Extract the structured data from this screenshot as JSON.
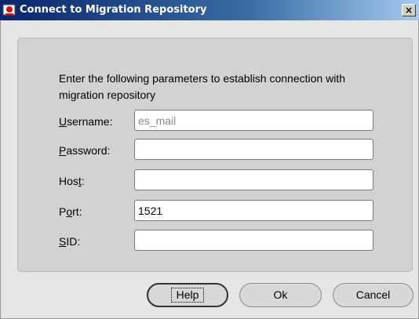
{
  "window": {
    "title": "Connect to Migration Repository",
    "close_glyph": "×",
    "icon": "oracle-app-icon"
  },
  "form": {
    "instructions": "Enter the following parameters to establish connection with migration repository",
    "username": {
      "mnemonic": "U",
      "rest": "sername:",
      "value": "es_mail",
      "enabled": false
    },
    "password": {
      "mnemonic": "P",
      "rest": "assword:",
      "value": ""
    },
    "host": {
      "pre": "Hos",
      "mnemonic": "t",
      "rest": ":",
      "value": ""
    },
    "port": {
      "pre": "P",
      "mnemonic": "o",
      "rest": "rt:",
      "value": "1521"
    },
    "sid": {
      "mnemonic": "S",
      "rest": "ID:",
      "value": ""
    }
  },
  "buttons": {
    "help": "Help",
    "ok": "Ok",
    "cancel": "Cancel"
  }
}
